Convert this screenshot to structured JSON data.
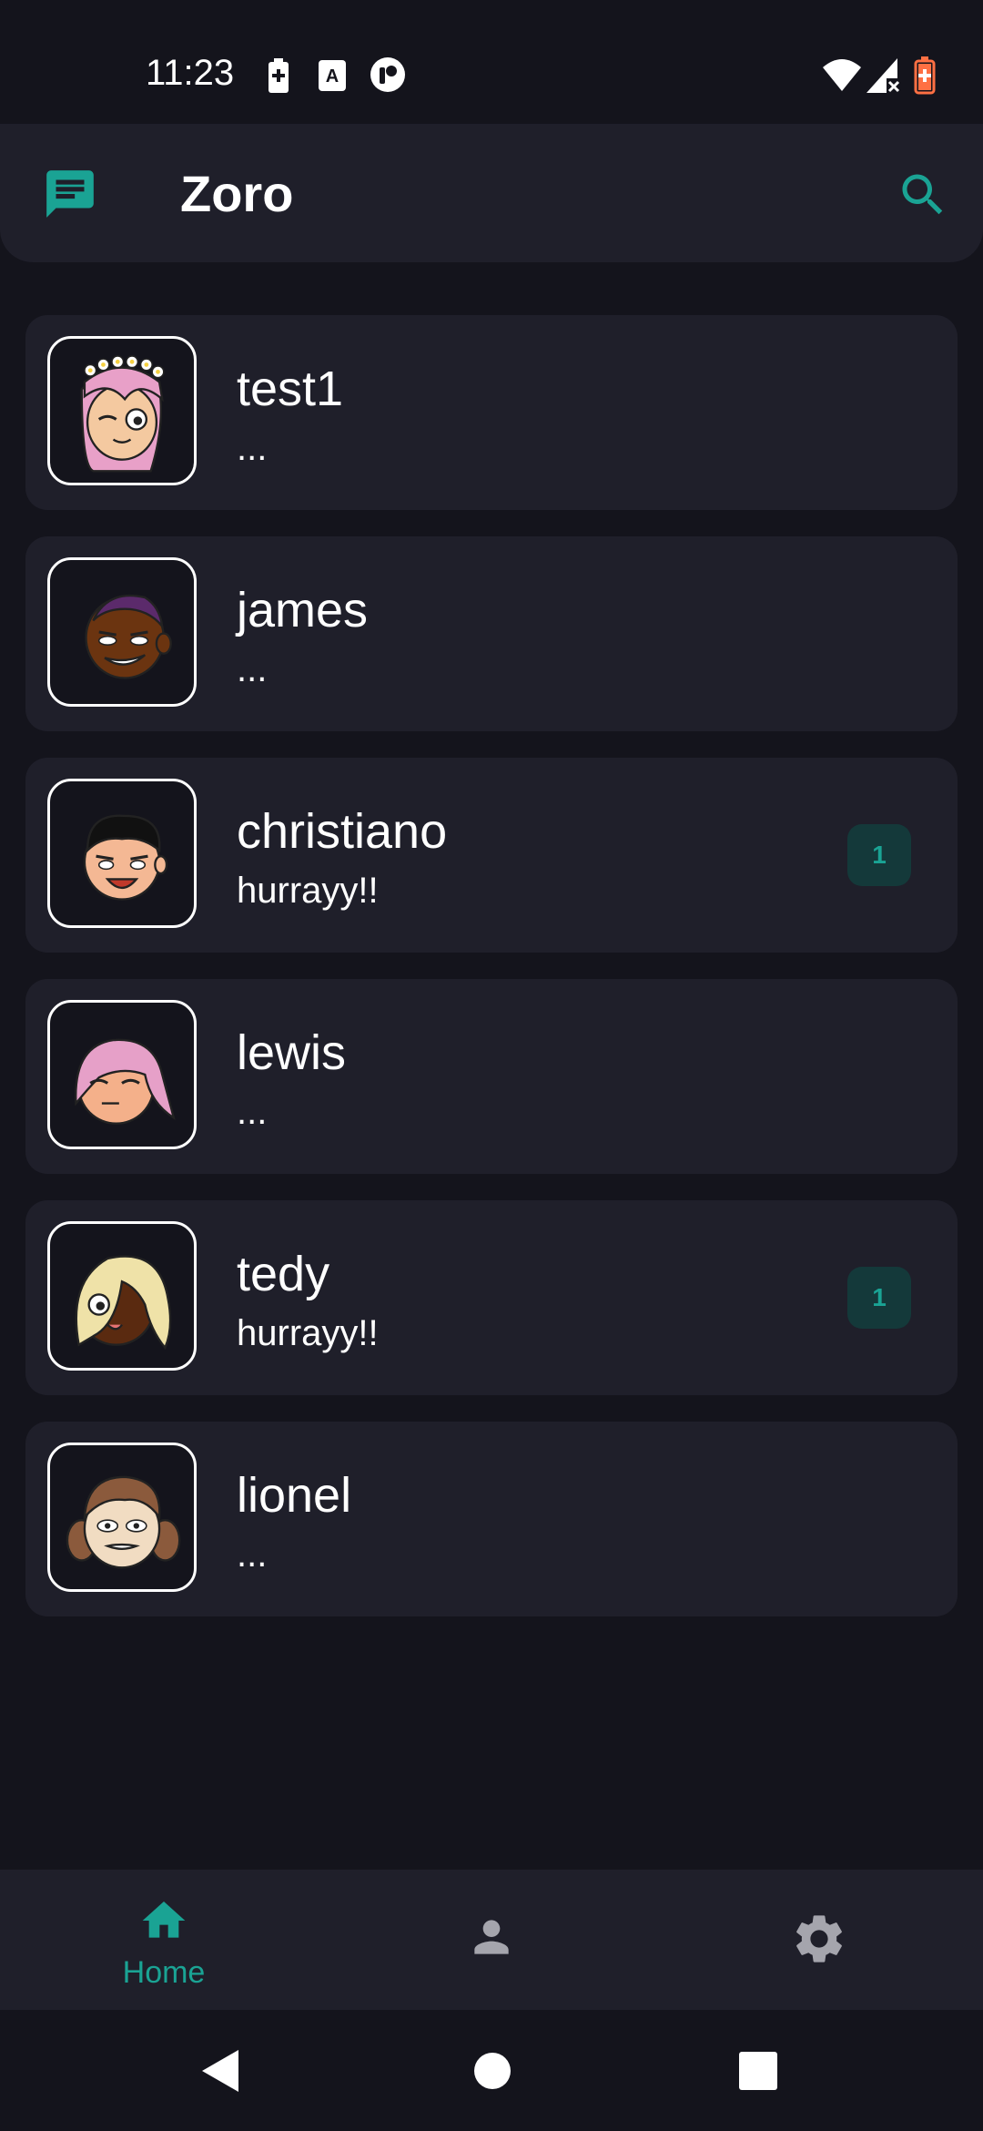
{
  "status_bar": {
    "time": "11:23"
  },
  "app_bar": {
    "title": "Zoro",
    "logo_icon": "chat-bubble-icon",
    "search_icon": "search-icon"
  },
  "colors": {
    "accent": "#1aa394",
    "background": "#14141c",
    "surface": "#1f1f2a",
    "badge_bg": "#14393a"
  },
  "chats": [
    {
      "name": "test1",
      "preview": "...",
      "unread": "",
      "avatar": "pink-hair-flower-crown-avatar"
    },
    {
      "name": "james",
      "preview": "...",
      "unread": "",
      "avatar": "dark-skin-purple-hair-avatar"
    },
    {
      "name": "christiano",
      "preview": "hurrayy!!",
      "unread": "1",
      "avatar": "black-hair-avatar"
    },
    {
      "name": "lewis",
      "preview": "...",
      "unread": "",
      "avatar": "pink-bob-hair-avatar"
    },
    {
      "name": "tedy",
      "preview": "hurrayy!!",
      "unread": "1",
      "avatar": "blonde-hair-avatar"
    },
    {
      "name": "lionel",
      "preview": "...",
      "unread": "",
      "avatar": "brown-pigtails-avatar"
    }
  ],
  "bottom_nav": {
    "home_label": "Home",
    "items": [
      "home-icon",
      "person-icon",
      "gear-icon"
    ]
  },
  "system_nav": [
    "back-icon",
    "home-circle-icon",
    "recents-icon"
  ]
}
